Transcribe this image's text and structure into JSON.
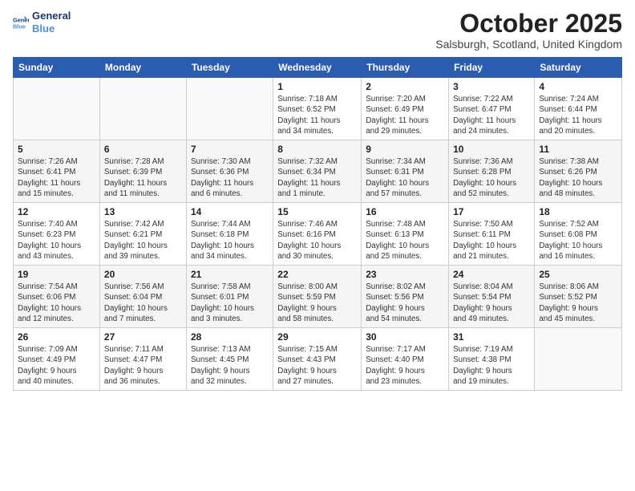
{
  "header": {
    "logo_line1": "General",
    "logo_line2": "Blue",
    "month": "October 2025",
    "location": "Salsburgh, Scotland, United Kingdom"
  },
  "weekdays": [
    "Sunday",
    "Monday",
    "Tuesday",
    "Wednesday",
    "Thursday",
    "Friday",
    "Saturday"
  ],
  "weeks": [
    [
      {
        "day": "",
        "info": ""
      },
      {
        "day": "",
        "info": ""
      },
      {
        "day": "",
        "info": ""
      },
      {
        "day": "1",
        "info": "Sunrise: 7:18 AM\nSunset: 6:52 PM\nDaylight: 11 hours\nand 34 minutes."
      },
      {
        "day": "2",
        "info": "Sunrise: 7:20 AM\nSunset: 6:49 PM\nDaylight: 11 hours\nand 29 minutes."
      },
      {
        "day": "3",
        "info": "Sunrise: 7:22 AM\nSunset: 6:47 PM\nDaylight: 11 hours\nand 24 minutes."
      },
      {
        "day": "4",
        "info": "Sunrise: 7:24 AM\nSunset: 6:44 PM\nDaylight: 11 hours\nand 20 minutes."
      }
    ],
    [
      {
        "day": "5",
        "info": "Sunrise: 7:26 AM\nSunset: 6:41 PM\nDaylight: 11 hours\nand 15 minutes."
      },
      {
        "day": "6",
        "info": "Sunrise: 7:28 AM\nSunset: 6:39 PM\nDaylight: 11 hours\nand 11 minutes."
      },
      {
        "day": "7",
        "info": "Sunrise: 7:30 AM\nSunset: 6:36 PM\nDaylight: 11 hours\nand 6 minutes."
      },
      {
        "day": "8",
        "info": "Sunrise: 7:32 AM\nSunset: 6:34 PM\nDaylight: 11 hours\nand 1 minute."
      },
      {
        "day": "9",
        "info": "Sunrise: 7:34 AM\nSunset: 6:31 PM\nDaylight: 10 hours\nand 57 minutes."
      },
      {
        "day": "10",
        "info": "Sunrise: 7:36 AM\nSunset: 6:28 PM\nDaylight: 10 hours\nand 52 minutes."
      },
      {
        "day": "11",
        "info": "Sunrise: 7:38 AM\nSunset: 6:26 PM\nDaylight: 10 hours\nand 48 minutes."
      }
    ],
    [
      {
        "day": "12",
        "info": "Sunrise: 7:40 AM\nSunset: 6:23 PM\nDaylight: 10 hours\nand 43 minutes."
      },
      {
        "day": "13",
        "info": "Sunrise: 7:42 AM\nSunset: 6:21 PM\nDaylight: 10 hours\nand 39 minutes."
      },
      {
        "day": "14",
        "info": "Sunrise: 7:44 AM\nSunset: 6:18 PM\nDaylight: 10 hours\nand 34 minutes."
      },
      {
        "day": "15",
        "info": "Sunrise: 7:46 AM\nSunset: 6:16 PM\nDaylight: 10 hours\nand 30 minutes."
      },
      {
        "day": "16",
        "info": "Sunrise: 7:48 AM\nSunset: 6:13 PM\nDaylight: 10 hours\nand 25 minutes."
      },
      {
        "day": "17",
        "info": "Sunrise: 7:50 AM\nSunset: 6:11 PM\nDaylight: 10 hours\nand 21 minutes."
      },
      {
        "day": "18",
        "info": "Sunrise: 7:52 AM\nSunset: 6:08 PM\nDaylight: 10 hours\nand 16 minutes."
      }
    ],
    [
      {
        "day": "19",
        "info": "Sunrise: 7:54 AM\nSunset: 6:06 PM\nDaylight: 10 hours\nand 12 minutes."
      },
      {
        "day": "20",
        "info": "Sunrise: 7:56 AM\nSunset: 6:04 PM\nDaylight: 10 hours\nand 7 minutes."
      },
      {
        "day": "21",
        "info": "Sunrise: 7:58 AM\nSunset: 6:01 PM\nDaylight: 10 hours\nand 3 minutes."
      },
      {
        "day": "22",
        "info": "Sunrise: 8:00 AM\nSunset: 5:59 PM\nDaylight: 9 hours\nand 58 minutes."
      },
      {
        "day": "23",
        "info": "Sunrise: 8:02 AM\nSunset: 5:56 PM\nDaylight: 9 hours\nand 54 minutes."
      },
      {
        "day": "24",
        "info": "Sunrise: 8:04 AM\nSunset: 5:54 PM\nDaylight: 9 hours\nand 49 minutes."
      },
      {
        "day": "25",
        "info": "Sunrise: 8:06 AM\nSunset: 5:52 PM\nDaylight: 9 hours\nand 45 minutes."
      }
    ],
    [
      {
        "day": "26",
        "info": "Sunrise: 7:09 AM\nSunset: 4:49 PM\nDaylight: 9 hours\nand 40 minutes."
      },
      {
        "day": "27",
        "info": "Sunrise: 7:11 AM\nSunset: 4:47 PM\nDaylight: 9 hours\nand 36 minutes."
      },
      {
        "day": "28",
        "info": "Sunrise: 7:13 AM\nSunset: 4:45 PM\nDaylight: 9 hours\nand 32 minutes."
      },
      {
        "day": "29",
        "info": "Sunrise: 7:15 AM\nSunset: 4:43 PM\nDaylight: 9 hours\nand 27 minutes."
      },
      {
        "day": "30",
        "info": "Sunrise: 7:17 AM\nSunset: 4:40 PM\nDaylight: 9 hours\nand 23 minutes."
      },
      {
        "day": "31",
        "info": "Sunrise: 7:19 AM\nSunset: 4:38 PM\nDaylight: 9 hours\nand 19 minutes."
      },
      {
        "day": "",
        "info": ""
      }
    ]
  ]
}
